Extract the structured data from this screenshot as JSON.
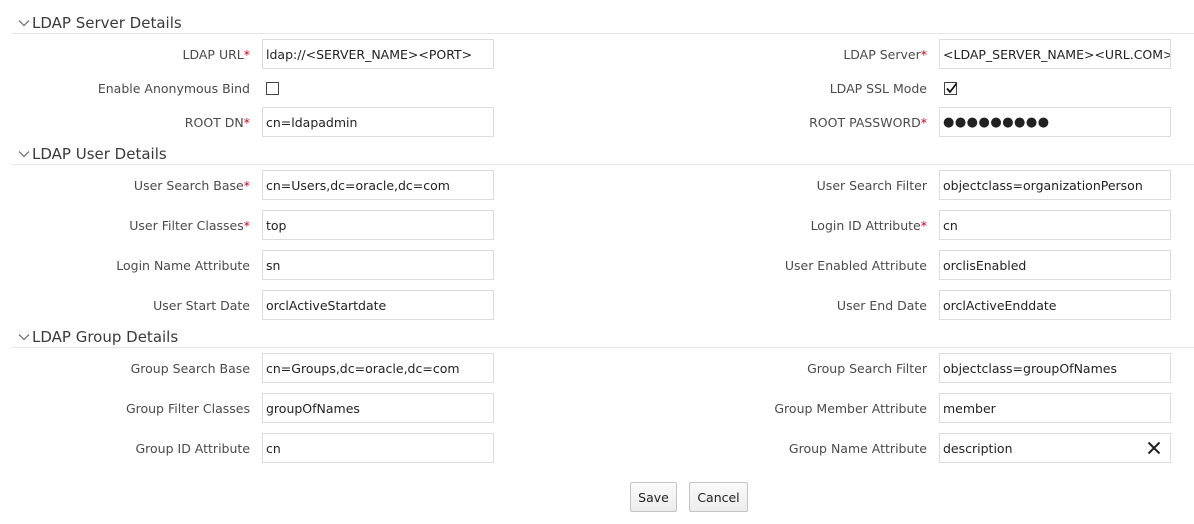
{
  "sections": {
    "server": {
      "title": "LDAP Server Details",
      "ldap_url": {
        "label": "LDAP URL",
        "value": "ldap://<SERVER_NAME><PORT>"
      },
      "ldap_server": {
        "label": "LDAP Server",
        "value": "<LDAP_SERVER_NAME><URL.COM>"
      },
      "anonymous_bind": {
        "label": "Enable Anonymous Bind",
        "checked": false
      },
      "ssl_mode": {
        "label": "LDAP SSL Mode",
        "checked": true
      },
      "root_dn": {
        "label": "ROOT DN",
        "value": "cn=ldapadmin"
      },
      "root_password": {
        "label": "ROOT PASSWORD",
        "value": "●●●●●●●●●"
      }
    },
    "user": {
      "title": "LDAP User Details",
      "user_search_base": {
        "label": "User Search Base",
        "value": "cn=Users,dc=oracle,dc=com"
      },
      "user_search_filter": {
        "label": "User Search Filter",
        "value": "objectclass=organizationPerson"
      },
      "user_filter_classes": {
        "label": "User Filter Classes",
        "value": "top"
      },
      "login_id_attribute": {
        "label": "Login ID Attribute",
        "value": "cn"
      },
      "login_name_attribute": {
        "label": "Login Name Attribute",
        "value": "sn"
      },
      "user_enabled_attribute": {
        "label": "User Enabled Attribute",
        "value": "orclisEnabled"
      },
      "user_start_date": {
        "label": "User Start Date",
        "value": "orclActiveStartdate"
      },
      "user_end_date": {
        "label": "User End Date",
        "value": "orclActiveEnddate"
      }
    },
    "group": {
      "title": "LDAP Group Details",
      "group_search_base": {
        "label": "Group Search Base",
        "value": "cn=Groups,dc=oracle,dc=com"
      },
      "group_search_filter": {
        "label": "Group Search Filter",
        "value": "objectclass=groupOfNames"
      },
      "group_filter_classes": {
        "label": "Group Filter Classes",
        "value": "groupOfNames"
      },
      "group_member_attribute": {
        "label": "Group Member Attribute",
        "value": "member"
      },
      "group_id_attribute": {
        "label": "Group ID Attribute",
        "value": "cn"
      },
      "group_name_attribute": {
        "label": "Group Name Attribute",
        "value": "description"
      }
    }
  },
  "required_marker": "*",
  "actions": {
    "save_label": "Save",
    "cancel_label": "Cancel"
  },
  "icons": {
    "section_toggle": "chevron-down-icon",
    "clear": "close-icon",
    "check": "checkmark-icon"
  },
  "colors": {
    "required": "#d0021b",
    "border": "#dcdcdc",
    "divider": "#e6e6e6"
  }
}
